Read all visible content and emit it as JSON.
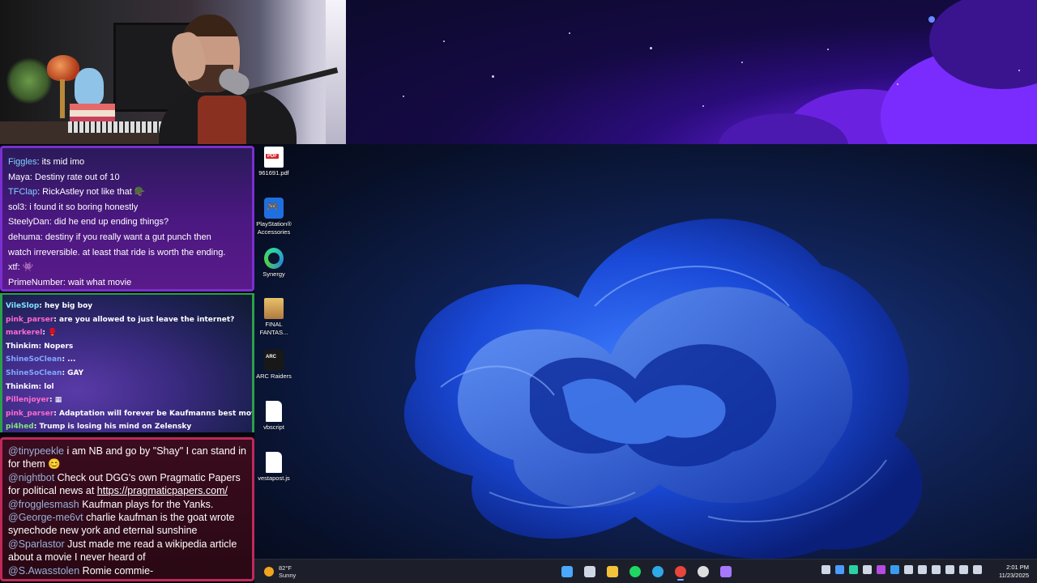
{
  "chat_top": {
    "messages": [
      {
        "user": "Figgles",
        "text": ": its mid imo",
        "color": "#7fd3ff"
      },
      {
        "user": "Maya",
        "text": ": Destiny rate out of 10",
        "color": "#ffffff"
      },
      {
        "user": "TFClap",
        "text": ": RickAstley not like that 🪖",
        "color": "#7fd3ff"
      },
      {
        "user": "sol3",
        "text": ": i found it so boring honestly",
        "color": "#ffffff"
      },
      {
        "user": "SteelyDan",
        "text": ": did he end up ending things?",
        "color": "#ffffff"
      },
      {
        "user": "dehuma",
        "text": ": destiny if you really want a gut punch then",
        "color": "#ffffff"
      },
      {
        "user": "",
        "text": "watch irreversible. at least that ride is worth the ending.",
        "color": "#ffffff"
      },
      {
        "user": "xtf",
        "text": ": 👾",
        "color": "#ffffff"
      },
      {
        "user": "PrimeNumber",
        "text": ": wait what movie",
        "color": "#ffffff"
      }
    ]
  },
  "chat_mid": {
    "messages": [
      {
        "user": "VileSlop",
        "text": ": hey big boy",
        "color": "#7fe3ff"
      },
      {
        "user": "pink_parser",
        "text": ": are you allowed to just leave the internet?",
        "color": "#ff6ad0"
      },
      {
        "user": "markerel",
        "text": ": 🥊",
        "color": "#ff6ad0"
      },
      {
        "user": "Thinkim",
        "text": ": Nopers",
        "color": "#ffffff"
      },
      {
        "user": "ShineSoClean",
        "text": ": ...",
        "color": "#7fa8ff"
      },
      {
        "user": "ShineSoClean",
        "text": ": GAY",
        "color": "#7fa8ff"
      },
      {
        "user": "Thinkim",
        "text": ": lol",
        "color": "#ffffff"
      },
      {
        "user": "Pillenjoyer",
        "text": ": ▦",
        "color": "#ff6ad0"
      },
      {
        "user": "pink_parser",
        "text": ": Adaptation will forever be Kaufmanns best movie",
        "color": "#ff6ad0"
      },
      {
        "user": "pi4hed",
        "text": ": Trump is losing his mind on Zelensky",
        "color": "#7fe37f"
      }
    ]
  },
  "chat_bottom": {
    "messages": [
      {
        "user": "@tinypeekle",
        "text": " i am NB and go by \"Shay\" I can stand in for them 😊"
      },
      {
        "user": "@nightbot",
        "text": " Check out DGG's own Pragmatic Papers for political news at ",
        "link": "https://pragmaticpapers.com/"
      },
      {
        "user": "@frogglesmash",
        "text": " Kaufman plays for the Yanks."
      },
      {
        "user": "@George-me6vt",
        "text": " charlie kaufman is the goat wrote synechode new york and eternal sunshine"
      },
      {
        "user": "@Sparlastor",
        "text": " Just made me read a wikipedia article about a movie I never heard of"
      },
      {
        "user": "@S.Awasstolen",
        "text": " Romie commie-"
      }
    ]
  },
  "desktop_icons": [
    {
      "label": "961691.pdf",
      "icon": "pdf-file-icon",
      "kind": "pdf"
    },
    {
      "label": "PlayStation® Accessories",
      "icon": "playstation-accessories-icon",
      "kind": "ps"
    },
    {
      "label": "Synergy",
      "icon": "synergy-icon",
      "kind": "syn"
    },
    {
      "label": "FINAL FANTAS...",
      "icon": "final-fantasy-icon",
      "kind": "ff"
    },
    {
      "label": "ARC Raiders",
      "icon": "arc-raiders-icon",
      "kind": "arc"
    },
    {
      "label": "vbscript",
      "icon": "blank-file-icon",
      "kind": "file"
    },
    {
      "label": "vestapost.js",
      "icon": "blank-file-icon",
      "kind": "file"
    }
  ],
  "taskbar": {
    "weather": {
      "temp": "82°F",
      "condition": "Sunny"
    },
    "apps": [
      {
        "name": "start-button",
        "color": "#4aa8ff"
      },
      {
        "name": "task-view-button",
        "color": "#cfd6e6"
      },
      {
        "name": "file-explorer-app",
        "color": "#f3c13a"
      },
      {
        "name": "spotify-app",
        "color": "#1ed760"
      },
      {
        "name": "edge-app",
        "color": "#2fa8e8"
      },
      {
        "name": "chrome-app",
        "color": "#e8453c",
        "active": true
      },
      {
        "name": "obs-app",
        "color": "#dddddd"
      },
      {
        "name": "ai-app",
        "color": "#a678ff"
      }
    ],
    "tray": [
      "#cfd6e6",
      "#4a9cff",
      "#2bd1a6",
      "#cfd6e6",
      "#b54be0",
      "#3a9cf0",
      "#cfd6e6",
      "#cfd6e6",
      "#cfd6e6",
      "#cfd6e6",
      "#cfd6e6",
      "#cfd6e6"
    ],
    "clock": {
      "time": "2:01 PM",
      "date": "11/23/2025"
    }
  }
}
